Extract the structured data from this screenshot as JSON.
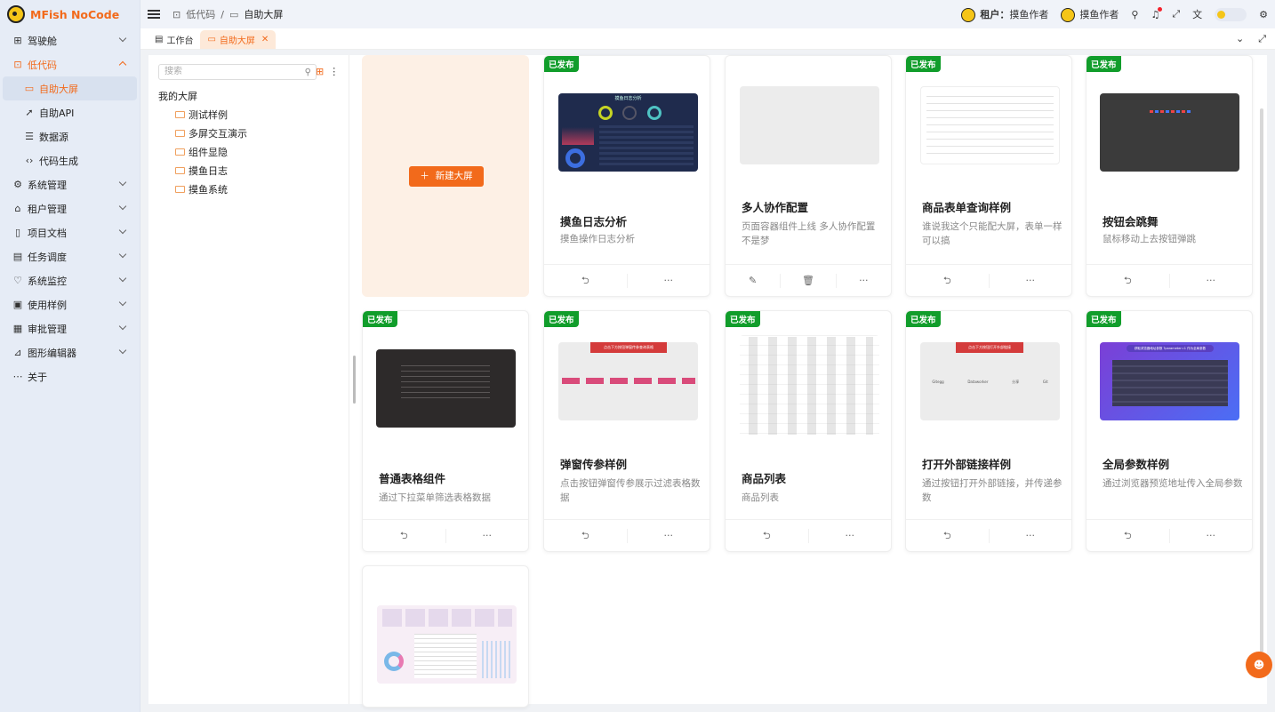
{
  "app": {
    "name": "MFish NoCode"
  },
  "sidebar": {
    "items": [
      {
        "label": "驾驶舱",
        "icon": "grid-icon"
      },
      {
        "label": "低代码",
        "icon": "lowcode-icon"
      },
      {
        "label": "自助大屏",
        "icon": "monitor-icon"
      },
      {
        "label": "自助API",
        "icon": "rocket-icon"
      },
      {
        "label": "数据源",
        "icon": "database-icon"
      },
      {
        "label": "代码生成",
        "icon": "code-icon"
      },
      {
        "label": "系统管理",
        "icon": "gear-icon"
      },
      {
        "label": "租户管理",
        "icon": "home-icon"
      },
      {
        "label": "项目文档",
        "icon": "book-icon"
      },
      {
        "label": "任务调度",
        "icon": "calendar-icon"
      },
      {
        "label": "系统监控",
        "icon": "heart-icon"
      },
      {
        "label": "使用样例",
        "icon": "sample-icon"
      },
      {
        "label": "审批管理",
        "icon": "approve-icon"
      },
      {
        "label": "图形编辑器",
        "icon": "chart-icon"
      },
      {
        "label": "关于",
        "icon": "about-icon"
      }
    ]
  },
  "header": {
    "breadcrumb": [
      "低代码",
      "自助大屏"
    ],
    "tenant_label": "租户：",
    "tenant_name": "摸鱼作者",
    "user_name": "摸鱼作者"
  },
  "tabs": [
    {
      "label": "工作台"
    },
    {
      "label": "自助大屏"
    }
  ],
  "tree": {
    "search_placeholder": "搜索",
    "root": "我的大屏",
    "folders": [
      "测试样例",
      "多屏交互演示",
      "组件显隐",
      "摸鱼日志",
      "摸鱼系统"
    ]
  },
  "new_button": "新建大屏",
  "badge_text": "已发布",
  "cards": [
    {
      "title": "摸鱼日志分析",
      "desc": "摸鱼操作日志分析",
      "published": true,
      "thumb": "dark"
    },
    {
      "title": "多人协作配置",
      "desc": "页面容器组件上线 多人协作配置不是梦",
      "published": false,
      "thumb": "gray"
    },
    {
      "title": "商品表单查询样例",
      "desc": "谁说我这个只能配大屏，表单一样可以搞",
      "published": true,
      "thumb": "white"
    },
    {
      "title": "按钮会跳舞",
      "desc": "鼠标移动上去按钮弹跳",
      "published": true,
      "thumb": "charcoal"
    },
    {
      "title": "普通表格组件",
      "desc": "通过下拉菜单筛选表格数据",
      "published": true,
      "thumb": "black"
    },
    {
      "title": "弹窗传参样例",
      "desc": "点击按钮弹窗传参展示过滤表格数据",
      "published": true,
      "thumb": "gray-buttons"
    },
    {
      "title": "商品列表",
      "desc": "商品列表",
      "published": true,
      "thumb": "table"
    },
    {
      "title": "打开外部链接样例",
      "desc": "通过按钮打开外部链接，并传递参数",
      "published": true,
      "thumb": "gray-links"
    },
    {
      "title": "全局参数样例",
      "desc": "通过浏览器预览地址传入全局参数",
      "published": true,
      "thumb": "purple"
    },
    {
      "title": "",
      "desc": "",
      "published": false,
      "thumb": "pink"
    }
  ],
  "thumb_texts": {
    "dark_title": "摸鱼日志分析",
    "popup_banner": "点击下方按钮弹窗传参查询表格",
    "link_banner": "点击下方按钮打开外部链接",
    "link_labels": [
      "Gitegg",
      "Dataworker",
      "分享",
      "Git"
    ],
    "purple_banner": "获取浏览器地址参数 ?parameter=1 作为全局参数"
  },
  "colors": {
    "accent": "#f26a1b",
    "published": "#119d2b"
  }
}
